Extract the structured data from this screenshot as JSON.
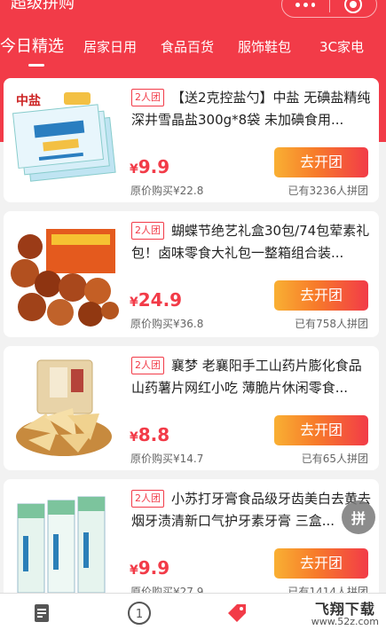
{
  "header": {
    "title": "超级拼购",
    "tabs": [
      {
        "label": "今日精选"
      },
      {
        "label": "居家日用"
      },
      {
        "label": "食品百货"
      },
      {
        "label": "服饰鞋包"
      },
      {
        "label": "3C家电"
      }
    ]
  },
  "products": [
    {
      "badge": "2人团",
      "desc": "【送2克控盐勺】中盐 无碘盐精纯深井雪晶盐300g*8袋 未加碘食用...",
      "price_currency": "¥",
      "price": "9.9",
      "orig_price": "原价购买¥22.8",
      "button": "去开团",
      "joined": "已有3236人拼团",
      "thumb_text": "中盐"
    },
    {
      "badge": "2人团",
      "desc": "蝴蝶节绝艺礼盒30包/74包荤素礼包！卤味零食大礼包一整箱组合装...",
      "price_currency": "¥",
      "price": "24.9",
      "orig_price": "原价购买¥36.8",
      "button": "去开团",
      "joined": "已有758人拼团"
    },
    {
      "badge": "2人团",
      "desc": "襄梦 老襄阳手工山药片膨化食品山药薯片网红小吃 薄脆片休闲零食...",
      "price_currency": "¥",
      "price": "8.8",
      "orig_price": "原价购买¥14.7",
      "button": "去开团",
      "joined": "已有65人拼团"
    },
    {
      "badge": "2人团",
      "desc": "小苏打牙膏食品级牙齿美白去黄去烟牙渍清新口气护牙素牙膏 三盒...",
      "price_currency": "¥",
      "price": "9.9",
      "orig_price": "原价购买¥27.9",
      "button": "去开团",
      "joined": "已有1414人拼团"
    }
  ],
  "float_button": "拼",
  "nav": {
    "center_label": "1"
  },
  "watermark": {
    "brand": "飞翔下载",
    "url": "www.52z.com"
  },
  "colors": {
    "accent": "#f23b48",
    "button_start": "#f9b033"
  }
}
